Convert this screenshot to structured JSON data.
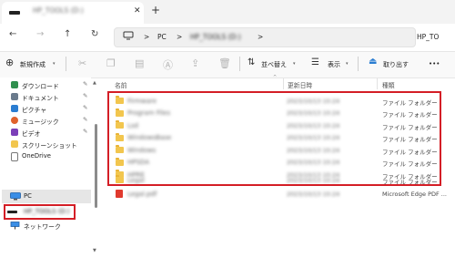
{
  "window": {
    "tab_title": "HP_TOOLS (D:)",
    "new_tab_label": "+",
    "close_label": "✕"
  },
  "nav": {
    "back_icon": "←",
    "forward_icon": "→",
    "up_icon": "↑",
    "refresh_icon": "↻",
    "breadcrumb": [
      "PC",
      "HP_TOOLS (D:)"
    ],
    "breadcrumb_sep": ">",
    "right_text": "HP_TO"
  },
  "toolbar": {
    "new_label": "新規作成",
    "sort_label": "並べ替え",
    "view_label": "表示",
    "eject_label": "取り出す",
    "more_label": "•••"
  },
  "sidebar": {
    "quick_items": [
      {
        "label": "ダウンロード",
        "icon": "download-icon",
        "color": "#2f8f4e",
        "pinned": true
      },
      {
        "label": "ドキュメント",
        "icon": "document-icon",
        "color": "#6a7a8c",
        "pinned": true
      },
      {
        "label": "ピクチャ",
        "icon": "pictures-icon",
        "color": "#2a7dd1",
        "pinned": true
      },
      {
        "label": "ミュージック",
        "icon": "music-icon",
        "color": "#e0622c",
        "pinned": true
      },
      {
        "label": "ビデオ",
        "icon": "video-icon",
        "color": "#7b3fb8",
        "pinned": true
      },
      {
        "label": "スクリーンショット",
        "icon": "folder-icon",
        "color": "#f2c64e",
        "pinned": false
      },
      {
        "label": "OneDrive",
        "icon": "file-icon",
        "color": "#ffffff",
        "pinned": false
      }
    ],
    "pin_glyph": "📌",
    "pc_label": "PC",
    "drive_label": "HP_TOOLS (D:)",
    "network_label": "ネットワーク"
  },
  "files": {
    "columns": {
      "name": "名前",
      "date": "更新日時",
      "type": "種類"
    },
    "rows": [
      {
        "name": "Firmware",
        "date": "2023/10/13 10:24",
        "type": "ファイル フォルダー",
        "kind": "folder"
      },
      {
        "name": "Program Files",
        "date": "2023/10/13 10:24",
        "type": "ファイル フォルダー",
        "kind": "folder"
      },
      {
        "name": "Lsd",
        "date": "2023/10/13 10:24",
        "type": "ファイル フォルダー",
        "kind": "folder"
      },
      {
        "name": "WindowsBase",
        "date": "2023/10/13 10:24",
        "type": "ファイル フォルダー",
        "kind": "folder"
      },
      {
        "name": "Windows",
        "date": "2023/10/13 10:24",
        "type": "ファイル フォルダー",
        "kind": "folder"
      },
      {
        "name": "HPSDA",
        "date": "2023/10/13 10:24",
        "type": "ファイル フォルダー",
        "kind": "folder"
      },
      {
        "name": "HPRE",
        "date": "2023/10/13 10:24",
        "type": "ファイル フォルダー",
        "kind": "folder"
      },
      {
        "name": "Legal",
        "date": "2023/10/13 10:24",
        "type": "ファイル フォルダー",
        "kind": "folder"
      },
      {
        "name": "Legal.pdf",
        "date": "2023/10/13 10:24",
        "type": "Microsoft Edge PDF ...",
        "kind": "pdf"
      }
    ]
  }
}
